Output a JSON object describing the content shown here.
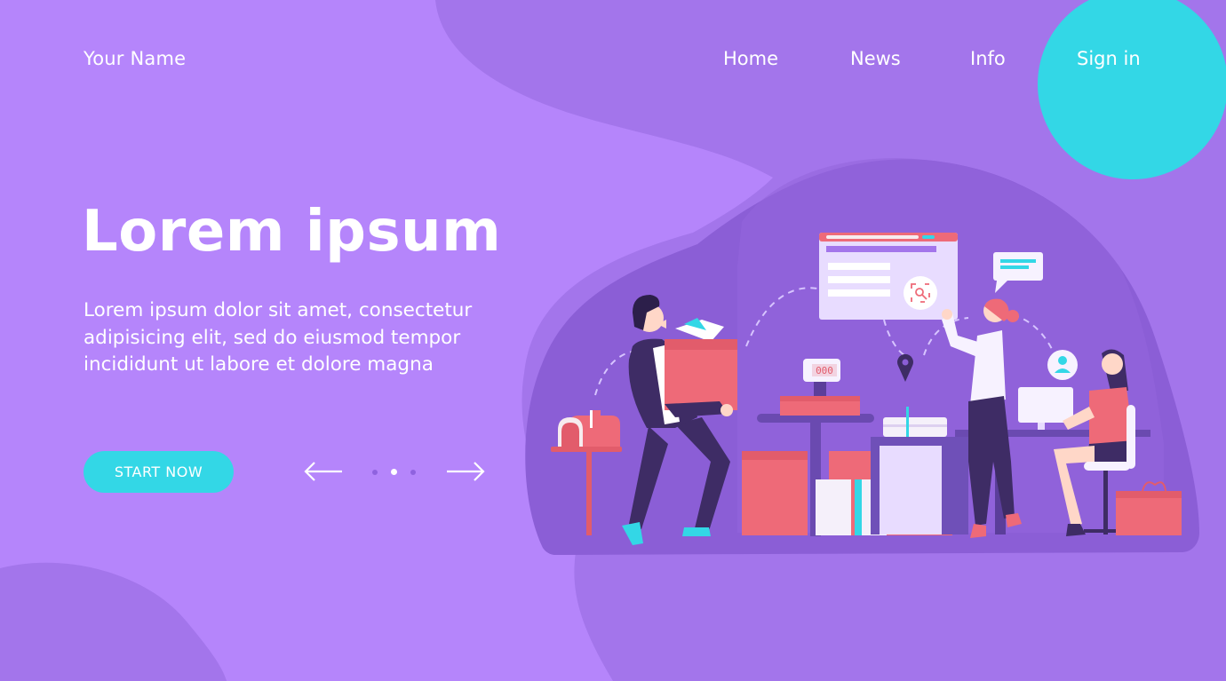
{
  "header": {
    "brand": "Your Name",
    "nav": [
      {
        "label": "Home"
      },
      {
        "label": "News"
      },
      {
        "label": "Info"
      },
      {
        "label": "Sign in"
      }
    ]
  },
  "hero": {
    "title": "Lorem ipsum",
    "body": "Lorem ipsum dolor sit amet, consectetur adipisicing elit, sed do eiusmod tempor incididunt ut labore et dolore magna",
    "cta_label": "START NOW"
  },
  "carousel": {
    "prev_icon": "arrow-left-icon",
    "next_icon": "arrow-right-icon",
    "total_slides": 3,
    "active_slide": 2
  },
  "illustration": {
    "scale_readout": "000"
  },
  "colors": {
    "background": "#b585fb",
    "accent_cyan": "#33d7e6",
    "dark_purple": "#8b5ed6",
    "coral": "#ee6a78"
  }
}
